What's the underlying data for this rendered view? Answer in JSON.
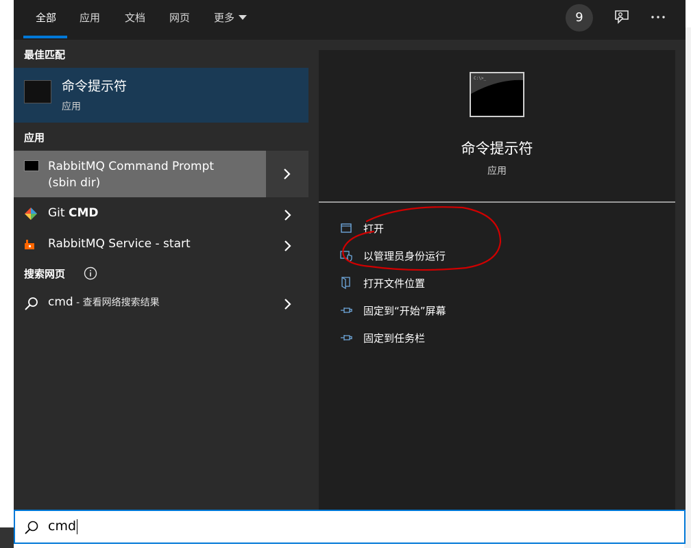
{
  "tabs": [
    {
      "label": "全部",
      "active": true
    },
    {
      "label": "应用"
    },
    {
      "label": "文档"
    },
    {
      "label": "网页"
    },
    {
      "label": "更多"
    }
  ],
  "badge_count": "9",
  "sections": {
    "best_match": "最佳匹配",
    "apps": "应用",
    "web": "搜索网页"
  },
  "best_match": {
    "title": "命令提示符",
    "subtitle": "应用"
  },
  "apps": [
    {
      "line1": "RabbitMQ Command Prompt",
      "line2": "(sbin dir)",
      "icon": "console-icon"
    },
    {
      "name": "Git ",
      "bold": "CMD",
      "icon": "git-icon"
    },
    {
      "name": "RabbitMQ Service - start",
      "icon": "rabbitmq-icon"
    }
  ],
  "web_result": {
    "query": "cmd",
    "suffix": " - 查看网络搜索结果"
  },
  "preview": {
    "title": "命令提示符",
    "subtitle": "应用"
  },
  "actions": [
    {
      "label": "打开",
      "icon": "open-window-icon"
    },
    {
      "label": "以管理员身份运行",
      "icon": "shield-icon"
    },
    {
      "label": "打开文件位置",
      "icon": "folder-icon"
    },
    {
      "label": "固定到“开始”屏幕",
      "icon": "pin-icon"
    },
    {
      "label": "固定到任务栏",
      "icon": "pin-icon"
    }
  ],
  "search": {
    "value": "cmd"
  },
  "colors": {
    "accent": "#0078d7",
    "annotation": "#d00000"
  }
}
